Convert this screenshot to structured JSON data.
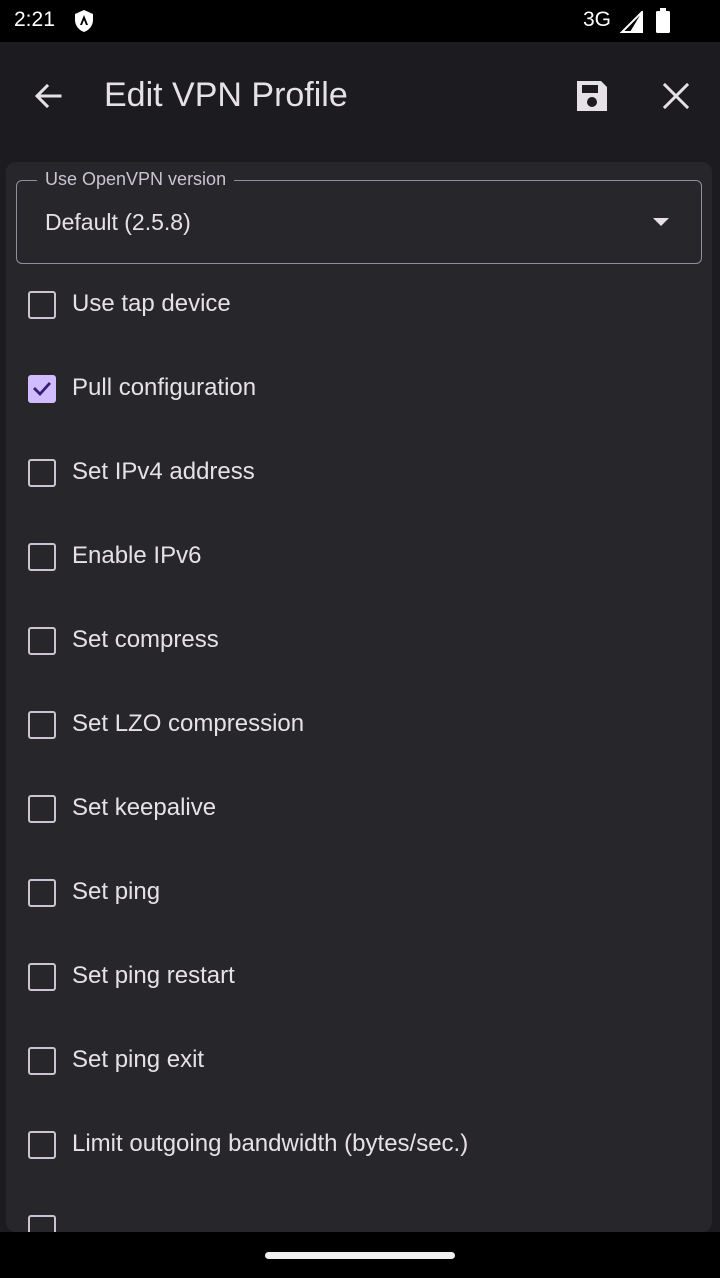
{
  "status_bar": {
    "time": "2:21",
    "network": "3G",
    "icons": [
      "shield-icon",
      "signal-icon",
      "battery-icon"
    ]
  },
  "app_bar": {
    "title": "Edit VPN Profile",
    "icons": [
      "arrow-back-icon",
      "save-icon",
      "close-icon"
    ]
  },
  "version_field": {
    "label": "Use OpenVPN version",
    "value": "Default (2.5.8)"
  },
  "options": [
    {
      "label": "Use tap device",
      "checked": false
    },
    {
      "label": "Pull configuration",
      "checked": true
    },
    {
      "label": "Set IPv4 address",
      "checked": false
    },
    {
      "label": "Enable IPv6",
      "checked": false
    },
    {
      "label": "Set compress",
      "checked": false
    },
    {
      "label": "Set LZO compression",
      "checked": false
    },
    {
      "label": "Set keepalive",
      "checked": false
    },
    {
      "label": "Set ping",
      "checked": false
    },
    {
      "label": "Set ping restart",
      "checked": false
    },
    {
      "label": "Set ping exit",
      "checked": false
    },
    {
      "label": "Limit outgoing bandwidth (bytes/sec.)",
      "checked": false
    }
  ],
  "colors": {
    "background": "#1c1b1f",
    "surface": "#27262b",
    "accent": "#d0bcff",
    "text": "#e6e1e5"
  }
}
